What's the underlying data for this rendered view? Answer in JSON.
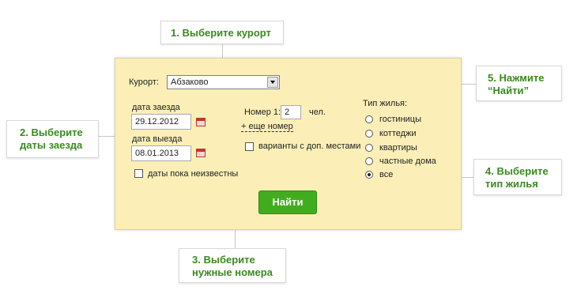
{
  "callouts": {
    "c1": "1. Выберите курорт",
    "c2a": "2. Выберите",
    "c2b": "даты заезда",
    "c3a": "3. Выберите",
    "c3b": "нужные номера",
    "c4a": "4. Выберите",
    "c4b": "тип жилья",
    "c5a": "5. Нажмите",
    "c5b": "“Найти”"
  },
  "form": {
    "resort_label": "Курорт:",
    "resort_value": "Абзаково",
    "checkin_label": "дата заезда",
    "checkin_value": "29.12.2012",
    "checkout_label": "дата выезда",
    "checkout_value": "08.01.2013",
    "unknown_dates": "даты пока неизвестны",
    "room_label": "Номер 1:",
    "room_value": "2",
    "room_unit": "чел.",
    "add_room": "+ еще номер",
    "extra_beds": "варианты с доп. местами",
    "housing_label": "Тип жилья:",
    "housing_options": [
      "гостиницы",
      "коттеджи",
      "квартиры",
      "частные дома",
      "все"
    ],
    "housing_selected": "все",
    "submit_label": "Найти"
  },
  "colors": {
    "accent": "#41ad1e",
    "callout_text": "#3a8a1f",
    "panel_bg": "#fbefb7"
  }
}
